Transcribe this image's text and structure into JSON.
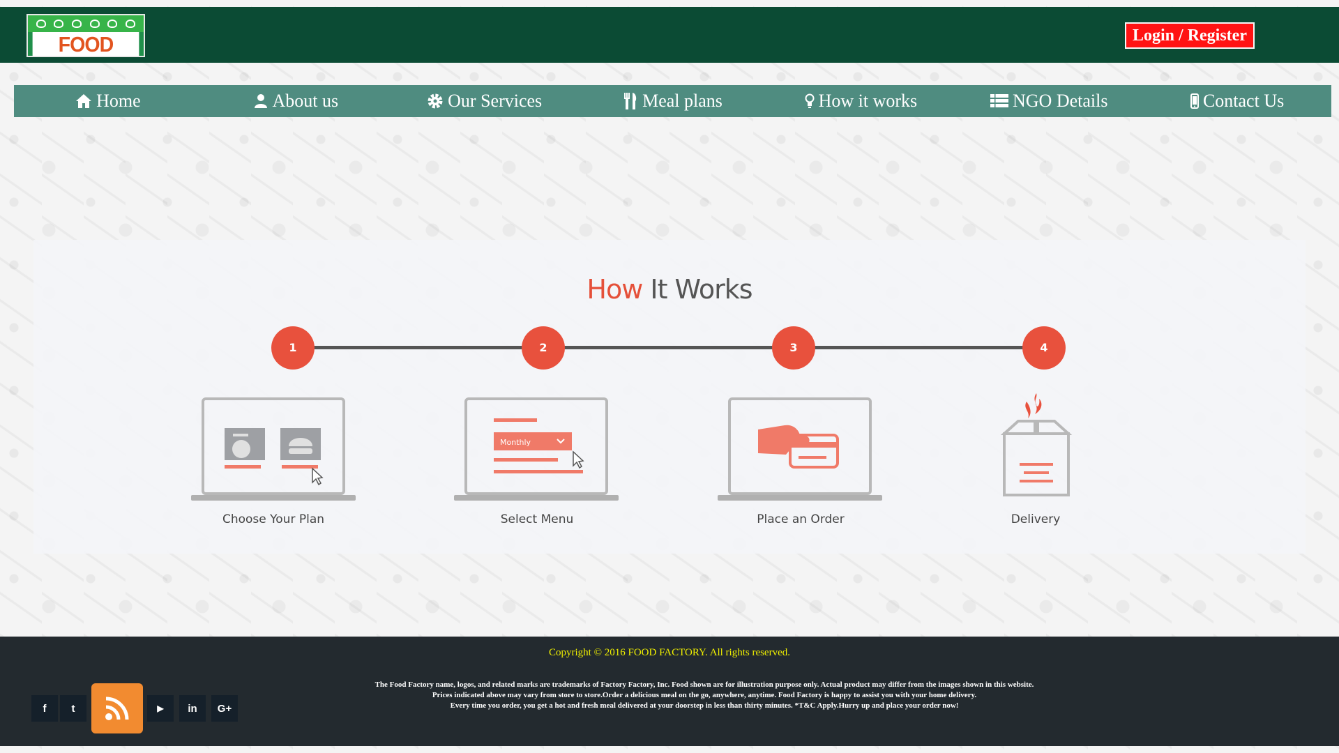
{
  "header": {
    "logo_text": "FOOD FACTORY",
    "login_label": "Login / Register"
  },
  "nav": {
    "items": [
      {
        "label": "Home",
        "icon": "home-icon"
      },
      {
        "label": "About us",
        "icon": "user-icon"
      },
      {
        "label": "Our Services",
        "icon": "gear-icon"
      },
      {
        "label": "Meal plans",
        "icon": "cutlery-icon"
      },
      {
        "label": "How it works",
        "icon": "lightbulb-icon"
      },
      {
        "label": "NGO Details",
        "icon": "list-icon"
      },
      {
        "label": "Contact Us",
        "icon": "mobile-icon"
      }
    ]
  },
  "how_it_works": {
    "title_accent": "How",
    "title_rest": " It Works",
    "steps": [
      {
        "number": "1",
        "label": "Choose Your Plan"
      },
      {
        "number": "2",
        "label": "Select Menu"
      },
      {
        "number": "3",
        "label": "Place an Order"
      },
      {
        "number": "4",
        "label": "Delivery"
      }
    ],
    "dropdown_text": "Monthly"
  },
  "footer": {
    "copyright": "Copyright © 2016      FOOD FACTORY. All rights reserved.",
    "disclaimer_lines": [
      "The Food Factory name, logos, and related marks are trademarks of Factory Factory, Inc. Food shown are for illustration purpose only. Actual product may differ from the images shown in this website.",
      "Prices indicated above may vary from store to store.Order a delicious meal on the go, anywhere, anytime. Food Factory is happy to assist you with your home delivery.",
      "Every time you order, you get a hot and fresh meal delivered at your doorstep in less than thirty minutes. *T&C Apply.Hurry up and place your order now!"
    ],
    "social": [
      {
        "name": "facebook-icon",
        "glyph": "f"
      },
      {
        "name": "twitter-icon",
        "glyph": "t"
      },
      {
        "name": "youtube-icon",
        "glyph": "▶"
      },
      {
        "name": "linkedin-icon",
        "glyph": "in"
      },
      {
        "name": "google-plus-icon",
        "glyph": "G+"
      }
    ]
  },
  "colors": {
    "header_bg": "#0b4b34",
    "nav_bg": "#4f8c80",
    "accent": "#e8513d",
    "login_bg": "#ff1313",
    "footer_bg": "#232a2f",
    "copyright": "#f0f000",
    "rss_bg": "#f28b30"
  }
}
